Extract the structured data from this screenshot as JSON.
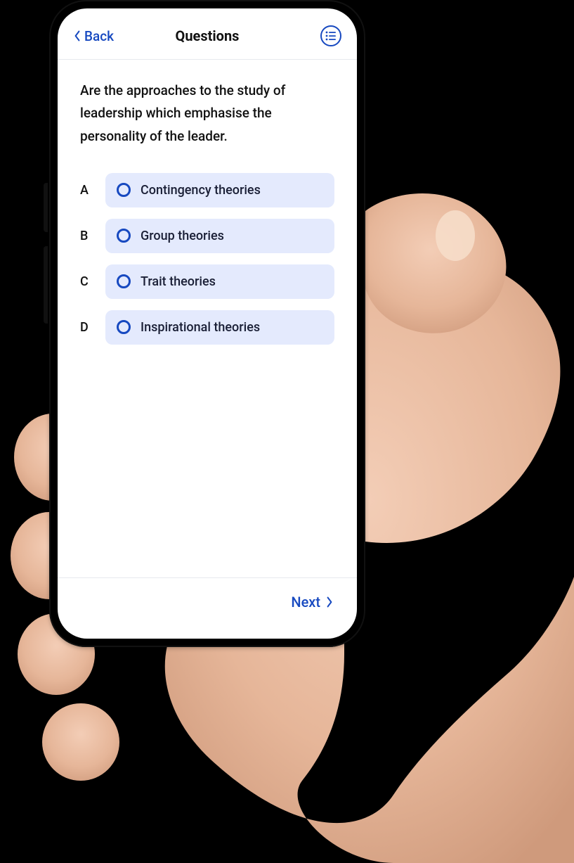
{
  "header": {
    "back_label": "Back",
    "title": "Questions"
  },
  "question": {
    "text": "Are the approaches to the study of leadership which emphasise  the personality of the leader.",
    "options": [
      {
        "letter": "A",
        "label": "Contingency theories"
      },
      {
        "letter": "B",
        "label": "Group theories"
      },
      {
        "letter": "C",
        "label": "Trait theories"
      },
      {
        "letter": "D",
        "label": "Inspirational theories"
      }
    ]
  },
  "footer": {
    "next_label": "Next"
  },
  "colors": {
    "accent": "#1749c0",
    "pill_bg": "#e4eafd"
  }
}
